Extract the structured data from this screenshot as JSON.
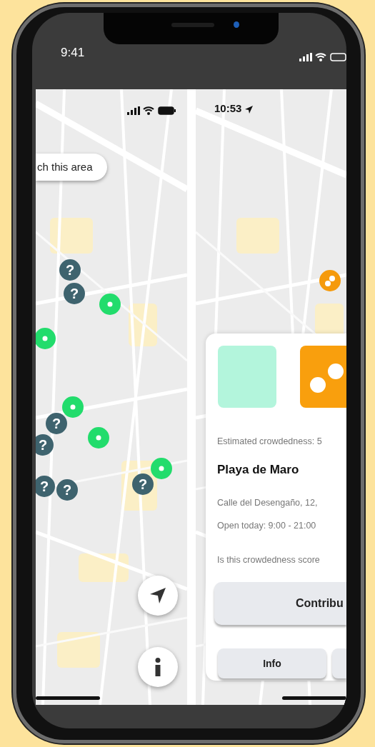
{
  "phone": {
    "time": "9:41"
  },
  "left_screen": {
    "search_button": "ch this area",
    "markers": [
      {
        "kind": "unknown",
        "label": "?"
      },
      {
        "kind": "unknown",
        "label": "?"
      },
      {
        "kind": "open"
      },
      {
        "kind": "open"
      },
      {
        "kind": "open"
      },
      {
        "kind": "unknown",
        "label": "?"
      },
      {
        "kind": "unknown",
        "label": "?"
      },
      {
        "kind": "open"
      },
      {
        "kind": "unknown",
        "label": "?"
      },
      {
        "kind": "unknown",
        "label": "?"
      },
      {
        "kind": "open"
      },
      {
        "kind": "unknown",
        "label": "?"
      }
    ],
    "map_buttons": [
      {
        "kind": "locate"
      },
      {
        "kind": "info"
      }
    ]
  },
  "right_screen": {
    "time": "10:53",
    "markers": [
      {
        "kind": "busy"
      }
    ],
    "card": {
      "crowdedness": "Estimated crowdedness: 5",
      "name": "Playa de Maro",
      "address": "Calle del Desengaño, 12,",
      "hours": "Open today: 9:00 - 21:00",
      "question": "Is this crowdedness score",
      "contribute_button": "Contribu",
      "buttons": [
        {
          "kind": "labeled",
          "label": "Info"
        },
        {
          "kind": "blank"
        }
      ]
    }
  }
}
